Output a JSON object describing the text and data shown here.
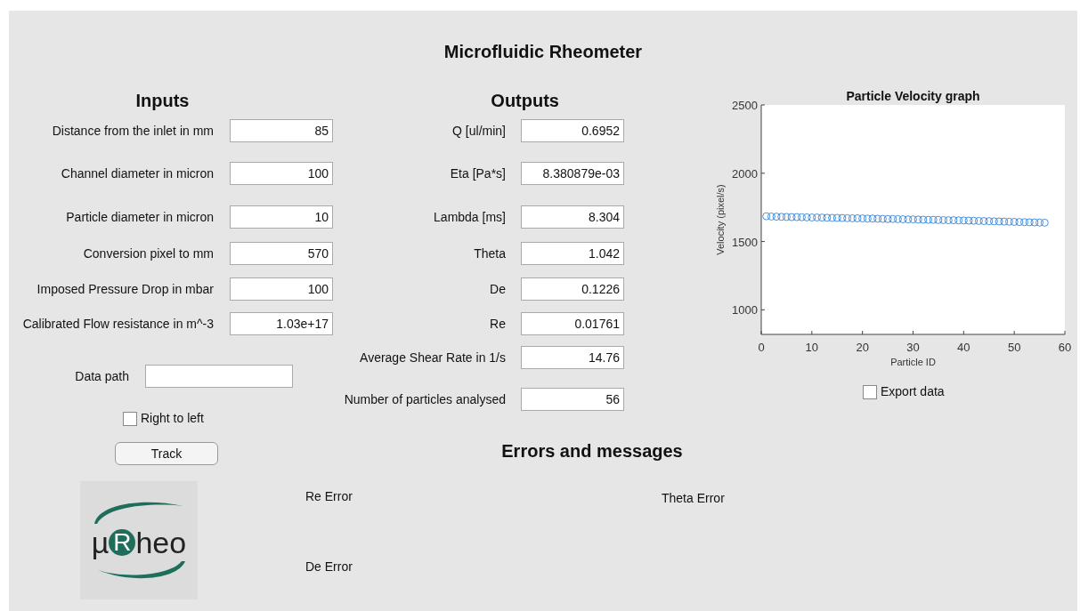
{
  "window": {
    "title": "Microfluidic Rheometer"
  },
  "inputs": {
    "heading": "Inputs",
    "fields": [
      {
        "label": "Distance from the inlet in mm",
        "value": "85"
      },
      {
        "label": "Channel diameter in micron",
        "value": "100"
      },
      {
        "label": "Particle diameter in micron",
        "value": "10"
      },
      {
        "label": "Conversion pixel to mm",
        "value": "570"
      },
      {
        "label": "Imposed Pressure Drop in mbar",
        "value": "100"
      },
      {
        "label": "Calibrated Flow resistance in m^-3",
        "value": "1.03e+17"
      }
    ],
    "data_path": {
      "label": "Data path"
    },
    "right_to_left": {
      "label": "Right to left",
      "checked": false
    },
    "track_button": "Track"
  },
  "outputs": {
    "heading": "Outputs",
    "fields": [
      {
        "label": "Q [ul/min]",
        "value": "0.6952"
      },
      {
        "label": "Eta [Pa*s]",
        "value": "8.380879e-03"
      },
      {
        "label": "Lambda [ms]",
        "value": "8.304"
      },
      {
        "label": "Theta",
        "value": "1.042"
      },
      {
        "label": "De",
        "value": "0.1226"
      },
      {
        "label": "Re",
        "value": "0.01761"
      },
      {
        "label": "Average Shear Rate in 1/s",
        "value": "14.76"
      },
      {
        "label": "Number of particles analysed",
        "value": "56"
      }
    ]
  },
  "graph": {
    "chart_data": {
      "type": "scatter",
      "title": "Particle Velocity graph",
      "xlabel": "Particle ID",
      "ylabel": "Velocity (pixel/s)",
      "xlim": [
        0,
        60
      ],
      "ylim": [
        820,
        2500
      ],
      "xticks": [
        0,
        10,
        20,
        30,
        40,
        50,
        60
      ],
      "yticks": [
        1000,
        1500,
        2000,
        2500
      ],
      "x": [
        1,
        2,
        3,
        4,
        5,
        6,
        7,
        8,
        9,
        10,
        11,
        12,
        13,
        14,
        15,
        16,
        17,
        18,
        19,
        20,
        21,
        22,
        23,
        24,
        25,
        26,
        27,
        28,
        29,
        30,
        31,
        32,
        33,
        34,
        35,
        36,
        37,
        38,
        39,
        40,
        41,
        42,
        43,
        44,
        45,
        46,
        47,
        48,
        49,
        50,
        51,
        52,
        53,
        54,
        55,
        56
      ],
      "series": [
        {
          "color": "#4a90d9",
          "values": [
            1685,
            1683,
            1682,
            1681,
            1680,
            1679,
            1679,
            1678,
            1677,
            1676,
            1676,
            1675,
            1674,
            1673,
            1673,
            1672,
            1671,
            1670,
            1670,
            1669,
            1668,
            1668,
            1667,
            1666,
            1665,
            1665,
            1664,
            1663,
            1662,
            1662,
            1661,
            1660,
            1659,
            1659,
            1658,
            1657,
            1656,
            1656,
            1655,
            1654,
            1653,
            1652,
            1651,
            1650,
            1649,
            1648,
            1647,
            1646,
            1645,
            1644,
            1643,
            1642,
            1641,
            1640,
            1639,
            1638
          ]
        }
      ]
    },
    "export": {
      "label": "Export data",
      "checked": false
    }
  },
  "messages": {
    "heading": "Errors and messages",
    "re_error": "Re Error",
    "theta_error": "Theta Error",
    "de_error": "De Error"
  },
  "logo": {
    "prefix": "µ",
    "initial": "R",
    "suffix": "heo"
  }
}
